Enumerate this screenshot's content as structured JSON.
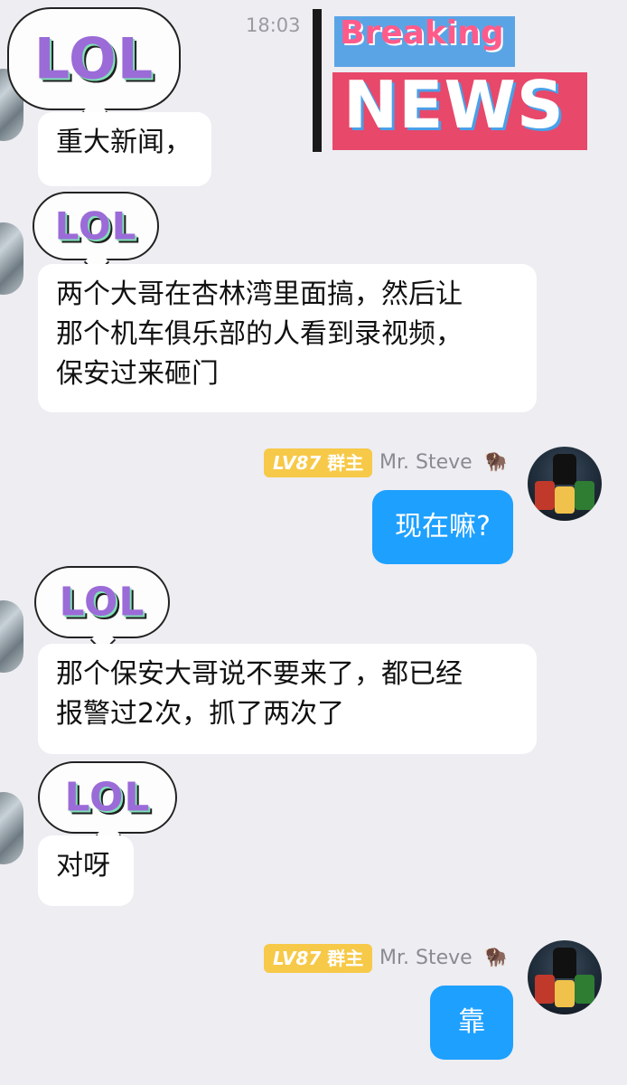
{
  "chat": {
    "timestamp": "18:03",
    "sticker_news": {
      "line1": "Breaking",
      "line2": "NEWS"
    },
    "lol_text": "LOL",
    "messages": [
      {
        "text": "重大新闻，"
      },
      {
        "text_lines": [
          "两个大哥在杏林湾里面搞，然后让",
          "那个机车俱乐部的人看到录视频，",
          "保安过来砸门"
        ]
      },
      {
        "sender": {
          "level": "LV87",
          "role": "群主",
          "name": "Mr. Steve"
        },
        "text": "现在嘛?"
      },
      {
        "text_lines": [
          "那个保安大哥说不要来了，都已经",
          "报警过2次，抓了两次了"
        ]
      },
      {
        "text": "对呀"
      },
      {
        "sender": {
          "level": "LV87",
          "role": "群主",
          "name": "Mr. Steve"
        },
        "text": "靠"
      }
    ]
  },
  "colors": {
    "background": "#ededf2",
    "my_bubble": "#1ea0ff",
    "other_bubble": "#ffffff",
    "badge": "#f7c948"
  }
}
